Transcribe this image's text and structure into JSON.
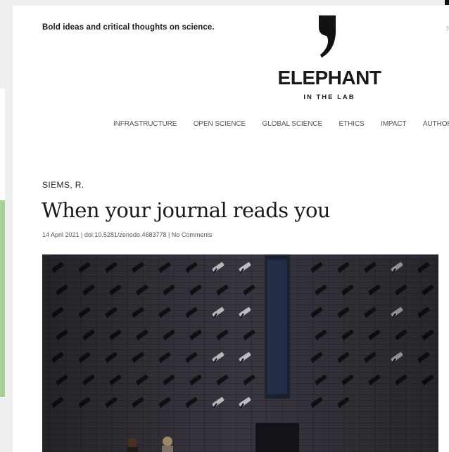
{
  "header": {
    "tagline": "Bold ideas and critical thoughts on science.",
    "corner_text": "N"
  },
  "logo": {
    "icon": "comma-mark-icon",
    "wordmark": "ELEPHANT",
    "subtitle": "IN THE LAB"
  },
  "nav": {
    "items": [
      "INFRASTRUCTURE",
      "OPEN SCIENCE",
      "GLOBAL SCIENCE",
      "ETHICS",
      "IMPACT",
      "AUTHORSH"
    ]
  },
  "article": {
    "author": "SIEMS, R.",
    "title": "When your journal reads you",
    "meta": "14 April 2021 | doi:10.5281/zenodo.4683778 | No Comments"
  },
  "hero_image": {
    "icon": "surveillance-cameras-wall-image"
  },
  "colors": {
    "accent_left": "#a9cf95",
    "wall": "#3a3640",
    "text": "#1a1a1a"
  }
}
